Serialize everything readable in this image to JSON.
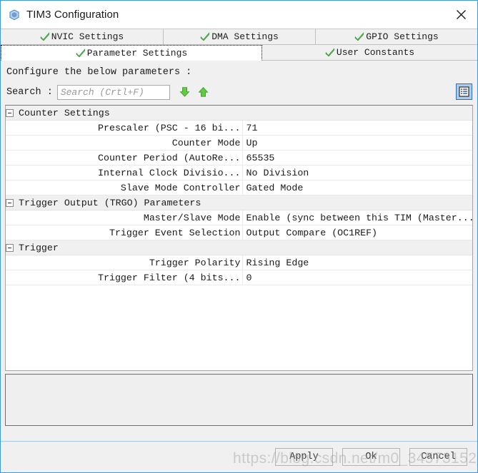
{
  "window": {
    "title": "TIM3 Configuration",
    "app_icon": "cube-icon",
    "close_icon": "close-icon",
    "accent_color": "#3d9ae0"
  },
  "tabs": {
    "row1": [
      {
        "label": "NVIC Settings",
        "icon": "check-icon",
        "selected": false
      },
      {
        "label": "DMA Settings",
        "icon": "check-icon",
        "selected": false
      },
      {
        "label": "GPIO Settings",
        "icon": "check-icon",
        "selected": false
      }
    ],
    "row2": [
      {
        "label": "Parameter Settings",
        "icon": "check-icon",
        "selected": true
      },
      {
        "label": "User Constants",
        "icon": "check-icon",
        "selected": false
      }
    ]
  },
  "main": {
    "configure_line": "Configure the below parameters :",
    "search": {
      "label": "Search :",
      "value": "",
      "placeholder": "Search (Crtl+F)",
      "down_icon": "arrow-down-icon",
      "up_icon": "arrow-up-icon"
    },
    "list_toggle_icon": "list-view-icon"
  },
  "table": {
    "groups": [
      {
        "title": "Counter Settings",
        "rows": [
          {
            "name": "Prescaler (PSC - 16 bi...",
            "value": "71"
          },
          {
            "name": "Counter Mode",
            "value": "Up"
          },
          {
            "name": "Counter Period (AutoRe...",
            "value": "65535"
          },
          {
            "name": "Internal Clock Divisio...",
            "value": "No Division"
          },
          {
            "name": "Slave Mode Controller",
            "value": "Gated Mode"
          }
        ]
      },
      {
        "title": "Trigger Output (TRGO) Parameters",
        "rows": [
          {
            "name": "Master/Slave Mode",
            "value": "Enable (sync between this TIM (Master..."
          },
          {
            "name": "Trigger Event Selection",
            "value": "Output Compare (OC1REF)"
          }
        ]
      },
      {
        "title": "Trigger",
        "rows": [
          {
            "name": "Trigger Polarity",
            "value": "Rising Edge"
          },
          {
            "name": "Trigger Filter (4 bits...",
            "value": "0"
          }
        ]
      }
    ]
  },
  "footer": {
    "apply_label": "Apply",
    "ok_label": "Ok",
    "cancel_label": "Cancel"
  },
  "watermark": {
    "line_a": "https://blog.csdn.net/m0_34573152",
    "line_b": "https://blog.csdn.net/m0_34573152"
  }
}
